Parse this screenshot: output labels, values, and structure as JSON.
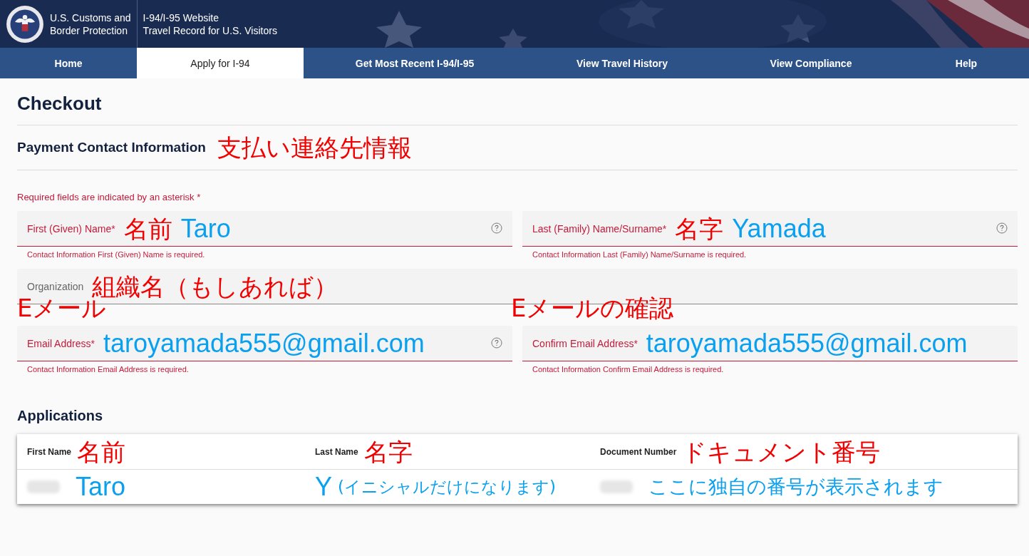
{
  "header": {
    "agency": [
      "U.S. Customs and",
      "Border Protection"
    ],
    "site": [
      "I-94/I-95 Website",
      "Travel Record for U.S. Visitors"
    ]
  },
  "nav": [
    {
      "label": "Home",
      "selected": false
    },
    {
      "label": "Apply for I-94",
      "selected": true
    },
    {
      "label": "Get Most Recent I-94/I-95",
      "selected": false
    },
    {
      "label": "View Travel History",
      "selected": false
    },
    {
      "label": "View Compliance",
      "selected": false
    },
    {
      "label": "Help",
      "selected": false
    }
  ],
  "page_title": "Checkout",
  "section": {
    "title": "Payment Contact Information",
    "annotation": "支払い連絡先情報"
  },
  "required_note": "Required fields are indicated by an asterisk *",
  "form_rows": [
    [
      {
        "kind": "inline",
        "label": "First (Given) Name*",
        "annotation": "名前",
        "value": "Taro",
        "help": true,
        "invalid": true,
        "error": "Contact Information First (Given) Name is required."
      },
      {
        "kind": "inline",
        "label": "Last (Family) Name/Surname*",
        "annotation": "名字",
        "value": "Yamada",
        "help": true,
        "invalid": true,
        "error": "Contact Information Last (Family) Name/Surname is required."
      }
    ],
    [
      {
        "kind": "inline",
        "label": "Organization",
        "annotation": "組織名（もしあれば）",
        "help": false,
        "invalid": false
      }
    ],
    [
      {
        "kind": "above",
        "label": "Email Address*",
        "annotation": "Eメール",
        "value": "taroyamada555@gmail.com",
        "help": true,
        "invalid": true,
        "error": "Contact Information Email Address is required."
      },
      {
        "kind": "above",
        "label": "Confirm Email Address*",
        "annotation": "Eメールの確認",
        "value": "taroyamada555@gmail.com",
        "help": false,
        "invalid": true,
        "error": "Contact Information Confirm Email Address is required."
      }
    ]
  ],
  "applications": {
    "title": "Applications",
    "columns": [
      {
        "label": "First Name",
        "annotation": "名前"
      },
      {
        "label": "Last Name",
        "annotation": "名字"
      },
      {
        "label": "Document Number",
        "annotation": "ドキュメント番号"
      }
    ],
    "rows": [
      [
        {
          "redacted": true,
          "value": "Taro"
        },
        {
          "redacted": false,
          "value": "Y",
          "note": "(イニシャルだけになります)"
        },
        {
          "redacted": true,
          "value": "ここに独自の番号が表示されます"
        }
      ]
    ]
  }
}
